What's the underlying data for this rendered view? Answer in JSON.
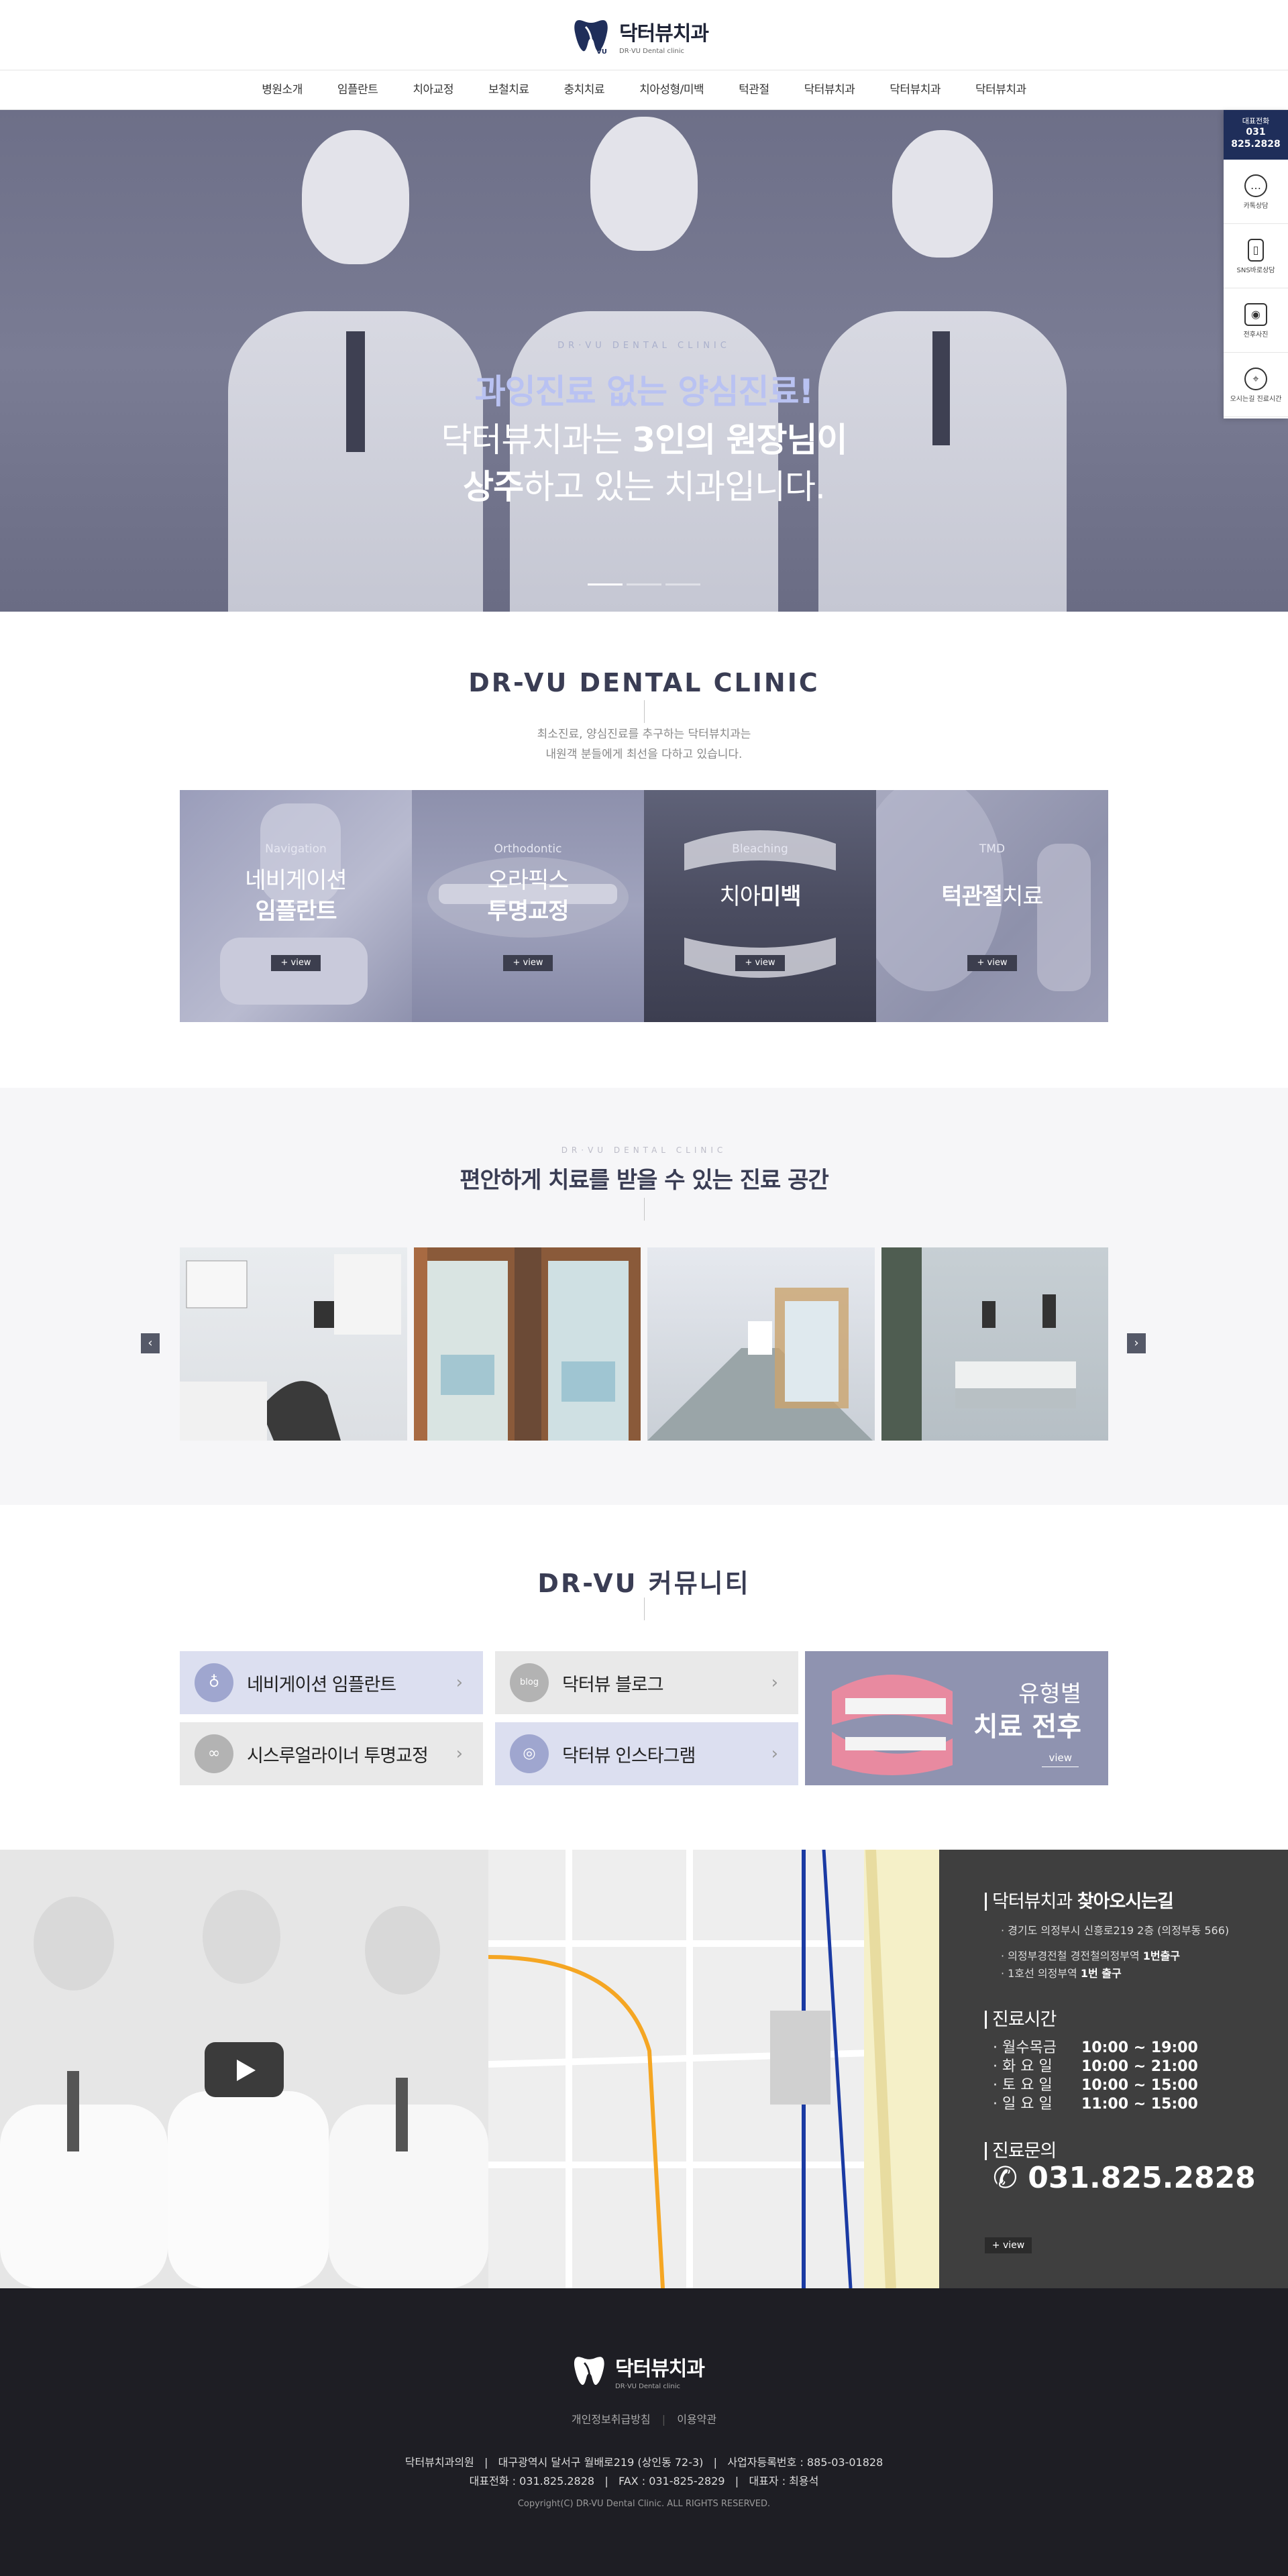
{
  "header": {
    "logo_ko": "닥터뷰치과",
    "logo_en": "DR·VU Dental clinic",
    "nav": [
      "병원소개",
      "임플란트",
      "치아교정",
      "보철치료",
      "충치치료",
      "치아성형/미백",
      "턱관절",
      "닥터뷰치과",
      "닥터뷰치과",
      "닥터뷰치과"
    ]
  },
  "hero": {
    "sub": "DR·VU DENTAL CLINIC",
    "line1": "과잉진료 없는 양심진료!",
    "line2_a": "닥터뷰치과는 ",
    "line2_b": "3인의 원장님이",
    "line3_a": "상주",
    "line3_b": "하고 있는 치과입니다."
  },
  "quick": {
    "phone_label": "대표전화",
    "phone_l1": "031",
    "phone_l2": "825.2828",
    "items": [
      {
        "label": "카톡상담",
        "icon": "chat-icon"
      },
      {
        "label": "SNS바로상담",
        "icon": "mobile-icon"
      },
      {
        "label": "전후사진",
        "icon": "camera-icon"
      },
      {
        "label": "오시는길 진료시간",
        "icon": "location-icon"
      }
    ]
  },
  "clinic": {
    "title": "DR-VU DENTAL CLINIC",
    "desc1": "최소진료, 양심진료를 추구하는 닥터뷰치과는",
    "desc2": "내원객 분들에게 최선을 다하고 있습니다.",
    "cards": [
      {
        "en": "Navigation",
        "ko_a": "네비게이션",
        "ko_b": "임플란트",
        "view": "+ view"
      },
      {
        "en": "Orthodontic",
        "ko_a": "오라픽스",
        "ko_b": "투명교정",
        "view": "+ view"
      },
      {
        "en": "Bleaching",
        "ko_a": "치아",
        "ko_b": "미백",
        "view": "+ view"
      },
      {
        "en": "TMD",
        "ko_a": "턱관절",
        "ko_b": "치료",
        "view": "+ view"
      }
    ]
  },
  "space": {
    "sub": "DR·VU DENTAL CLINIC",
    "title": "편안하게 치료를 받을 수 있는 진료 공간",
    "prev": "‹",
    "next": "›"
  },
  "community": {
    "title": "DR-VU 커뮤니티",
    "items": [
      {
        "label": "네비게이션 임플란트",
        "icon": "tooth-icon"
      },
      {
        "label": "닥터뷰 블로그",
        "icon": "blog-icon"
      },
      {
        "label": "시스루얼라이너 투명교정",
        "icon": "aligner-icon"
      },
      {
        "label": "닥터뷰 인스타그램",
        "icon": "instagram-icon"
      }
    ],
    "ba_line1": "유형별",
    "ba_line2": "치료 전후",
    "ba_view": "view"
  },
  "location": {
    "title_a": "닥터뷰치과 ",
    "title_b": "찾아오시는길",
    "addr": "· 경기도 의정부시 신흥로219 2층 (의정부동 566)",
    "sub1_a": "· 의정부경전철 경전철의정부역 ",
    "sub1_b": "1번출구",
    "sub2_a": "· 1호선 의정부역 ",
    "sub2_b": "1번 출구",
    "hours_title": "진료시간",
    "hours": [
      {
        "day": "· 월수목금",
        "time": "10:00 ~ 19:00"
      },
      {
        "day": "· 화 요 일",
        "time": "10:00 ~ 21:00"
      },
      {
        "day": "· 토 요 일",
        "time": "10:00 ~ 15:00"
      },
      {
        "day": "· 일 요 일",
        "time": "11:00 ~ 15:00"
      }
    ],
    "contact_title": "진료문의",
    "phone": "031.825.2828",
    "view": "+ view"
  },
  "footer": {
    "logo_ko": "닥터뷰치과",
    "logo_en": "DR·VU Dental clinic",
    "privacy": "개인정보취급방침",
    "terms": "이용약관",
    "info1": "닥터뷰치과의원   |   대구광역시 달서구 월배로219 (상인동 72-3)   |   사업자등록번호 : 885-03-01828",
    "info2": "대표전화 : 031.825.2828   |   FAX : 031-825-2829   |   대표자 : 최용석",
    "copyright": "Copyright(C) DR-VU Dental Clinic. ALL RIGHTS RESERVED."
  }
}
